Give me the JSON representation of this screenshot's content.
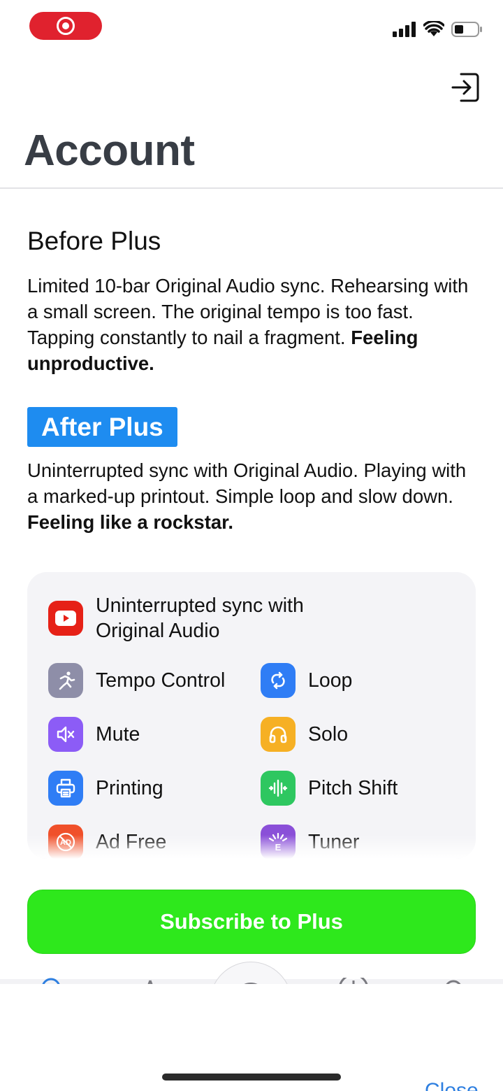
{
  "header": {
    "title": "Account",
    "logout_icon": "logout-icon"
  },
  "before": {
    "title": "Before Plus",
    "text": "Limited 10-bar Original Audio sync. Rehearsing with a small screen. The original tempo is too fast. Tapping constantly to nail a fragment. ",
    "emphasis": "Feeling unproductive."
  },
  "after": {
    "badge": "After Plus",
    "text": "Uninterrupted sync with Original Audio. Playing with a marked-up printout. Simple loop and slow down. ",
    "emphasis": "Feeling like a rockstar."
  },
  "features": [
    {
      "label": "Uninterrupted sync with Original Audio",
      "icon": "youtube-play-icon",
      "color": "#e62117"
    },
    {
      "label": "Tempo Control",
      "icon": "running-person-icon",
      "color": "#8e8ea8"
    },
    {
      "label": "Loop",
      "icon": "loop-icon",
      "color": "#2f7df5"
    },
    {
      "label": "Mute",
      "icon": "speaker-mute-icon",
      "color": "#8c5cf6"
    },
    {
      "label": "Solo",
      "icon": "headphones-icon",
      "color": "#f6b024"
    },
    {
      "label": "Printing",
      "icon": "printer-icon",
      "color": "#2f7df5"
    },
    {
      "label": "Pitch Shift",
      "icon": "pitch-shift-icon",
      "color": "#2ec760"
    },
    {
      "label": "Ad Free",
      "icon": "ad-free-icon",
      "color": "#f0502a"
    },
    {
      "label": "Tuner",
      "icon": "tuner-icon",
      "color": "#8a4fd8"
    }
  ],
  "subscribe": {
    "label": "Subscribe to Plus",
    "color": "#2ee81c"
  },
  "sheet": {
    "close_label": "Close"
  },
  "colors": {
    "accent_blue": "#1e8cf0",
    "record": "#e0222e"
  }
}
